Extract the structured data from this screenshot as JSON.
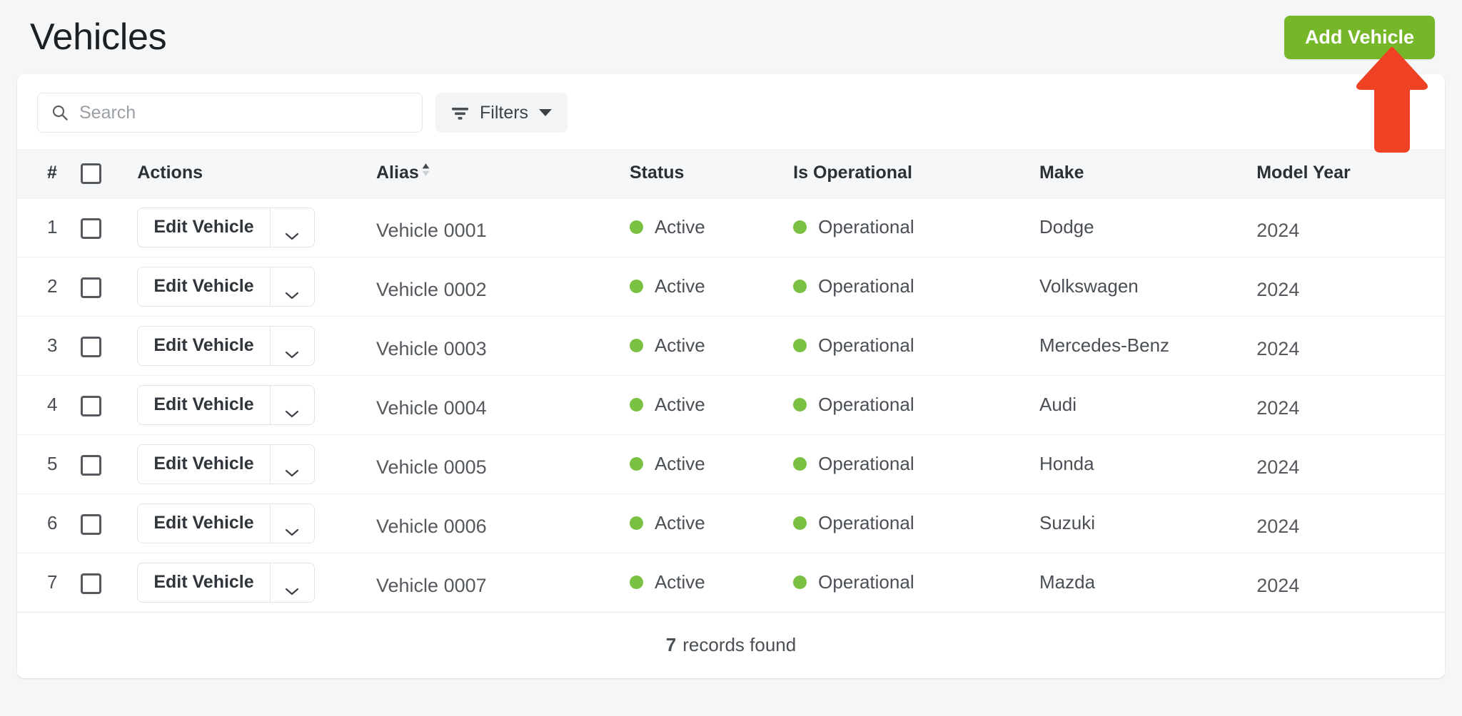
{
  "header": {
    "title": "Vehicles",
    "add_button_label": "Add Vehicle",
    "accent_green": "#76b729",
    "annotation_arrow_color": "#ef4123"
  },
  "toolbar": {
    "search_placeholder": "Search",
    "search_value": "",
    "filters_label": "Filters"
  },
  "table": {
    "columns": [
      {
        "key": "num",
        "label": "#"
      },
      {
        "key": "check",
        "label": ""
      },
      {
        "key": "actions",
        "label": "Actions"
      },
      {
        "key": "alias",
        "label": "Alias",
        "sortable": true,
        "sort_direction": "asc"
      },
      {
        "key": "status",
        "label": "Status"
      },
      {
        "key": "operational",
        "label": "Is Operational"
      },
      {
        "key": "make",
        "label": "Make"
      },
      {
        "key": "model_year",
        "label": "Model Year"
      }
    ],
    "row_action_label": "Edit Vehicle",
    "status_dot_color": "#7ac143",
    "rows": [
      {
        "num": "1",
        "alias": "Vehicle 0001",
        "status": "Active",
        "operational": "Operational",
        "make": "Dodge",
        "model_year": "2024"
      },
      {
        "num": "2",
        "alias": "Vehicle 0002",
        "status": "Active",
        "operational": "Operational",
        "make": "Volkswagen",
        "model_year": "2024"
      },
      {
        "num": "3",
        "alias": "Vehicle 0003",
        "status": "Active",
        "operational": "Operational",
        "make": "Mercedes-Benz",
        "model_year": "2024"
      },
      {
        "num": "4",
        "alias": "Vehicle 0004",
        "status": "Active",
        "operational": "Operational",
        "make": "Audi",
        "model_year": "2024"
      },
      {
        "num": "5",
        "alias": "Vehicle 0005",
        "status": "Active",
        "operational": "Operational",
        "make": "Honda",
        "model_year": "2024"
      },
      {
        "num": "6",
        "alias": "Vehicle 0006",
        "status": "Active",
        "operational": "Operational",
        "make": "Suzuki",
        "model_year": "2024"
      },
      {
        "num": "7",
        "alias": "Vehicle 0007",
        "status": "Active",
        "operational": "Operational",
        "make": "Mazda",
        "model_year": "2024"
      }
    ]
  },
  "footer": {
    "count": "7",
    "records_label": "records found"
  }
}
